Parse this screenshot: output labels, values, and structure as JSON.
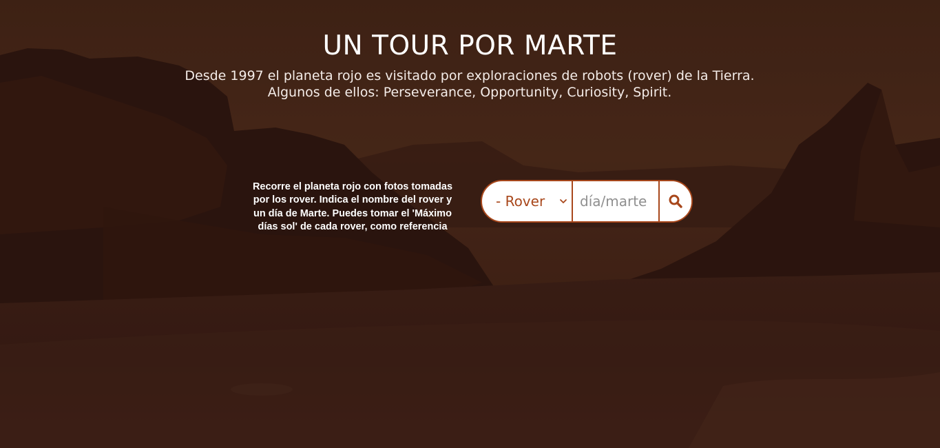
{
  "hero": {
    "title": "UN TOUR POR MARTE",
    "subtitle_line1": "Desde 1997 el planeta rojo es visitado por exploraciones de robots (rover) de la Tierra.",
    "subtitle_line2": "Algunos de ellos: Perseverance, Opportunity, Curiosity, Spirit."
  },
  "instructions": {
    "text": "Recorre el planeta rojo con fotos tomadas por los rover. Indica el nombre del rover y un día de Marte. Puedes tomar el 'Máximo días sol' de cada rover, como referencia"
  },
  "search": {
    "rover_selected": "- Rover",
    "sol_placeholder": "día/marte",
    "sol_value": "",
    "button_icon": "search-icon"
  },
  "colors": {
    "accent": "#a8471b",
    "background": "#3a1e14",
    "text": "#ffffff"
  }
}
